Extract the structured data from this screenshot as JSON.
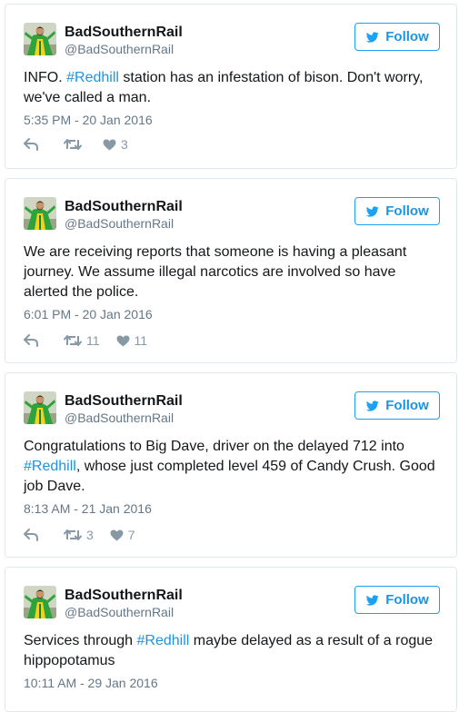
{
  "colors": {
    "link": "#1b95e0",
    "muted": "#657786",
    "icon": "#8899a6",
    "border": "#e1e8ed",
    "follow_border": "#1da1f2"
  },
  "icons": {
    "follow": "twitter-bird-icon",
    "reply": "reply-icon",
    "retweet": "retweet-icon",
    "like": "heart-icon"
  },
  "tweets": [
    {
      "name": "BadSouthernRail",
      "handle": "@BadSouthernRail",
      "follow_label": "Follow",
      "text_before": "INFO. ",
      "hashtag": "#Redhill",
      "text_after": " station has an infestation of bison. Don't worry, we've called a man.",
      "timestamp": "5:35 PM - 20 Jan 2016",
      "retweets": "",
      "likes": "3"
    },
    {
      "name": "BadSouthernRail",
      "handle": "@BadSouthernRail",
      "follow_label": "Follow",
      "text_before": "We are receiving reports that someone is having a pleasant journey. We assume illegal narcotics are involved so have alerted the police.",
      "hashtag": "",
      "text_after": "",
      "timestamp": "6:01 PM - 20 Jan 2016",
      "retweets": "11",
      "likes": "11"
    },
    {
      "name": "BadSouthernRail",
      "handle": "@BadSouthernRail",
      "follow_label": "Follow",
      "text_before": "Congratulations to Big Dave, driver on the delayed 712 into ",
      "hashtag": "#Redhill",
      "text_after": ", whose just completed level 459 of Candy Crush. Good job Dave.",
      "timestamp": "8:13 AM - 21 Jan 2016",
      "retweets": "3",
      "likes": "7"
    },
    {
      "name": "BadSouthernRail",
      "handle": "@BadSouthernRail",
      "follow_label": "Follow",
      "text_before": "Services through ",
      "hashtag": "#Redhill",
      "text_after": " maybe delayed as a result of a rogue hippopotamus",
      "timestamp": "10:11 AM - 29 Jan 2016",
      "retweets": "",
      "likes": ""
    }
  ]
}
